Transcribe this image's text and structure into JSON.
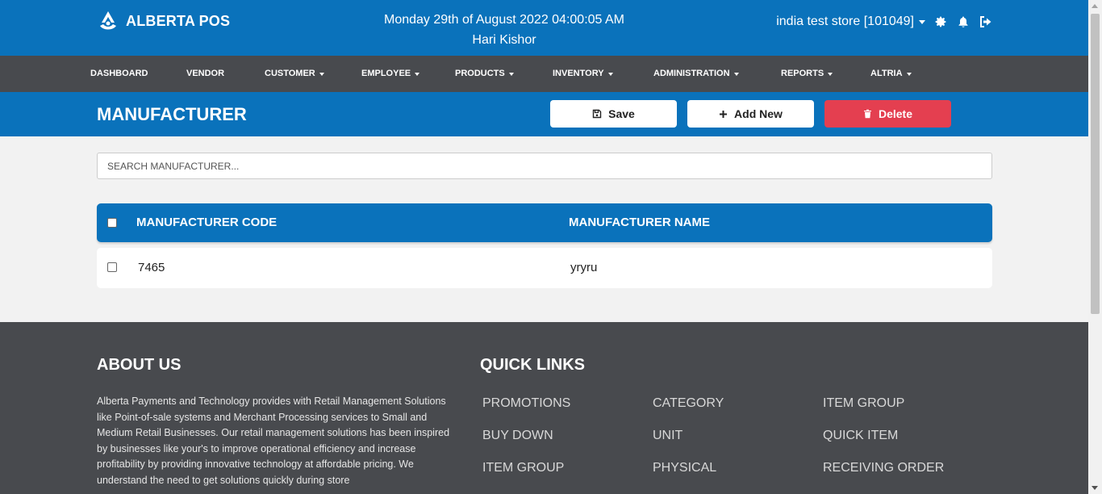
{
  "header": {
    "brand": "ALBERTA POS",
    "datetime": "Monday 29th of August 2022 04:00:05 AM",
    "user": "Hari Kishor",
    "store": "india test store [101049]"
  },
  "nav": {
    "dashboard": "DASHBOARD",
    "vendor": "VENDOR",
    "customer": "CUSTOMER",
    "employee": "EMPLOYEE",
    "products": "PRODUCTS",
    "inventory": "INVENTORY",
    "administration": "ADMINISTRATION",
    "reports": "REPORTS",
    "altria": "ALTRIA"
  },
  "page": {
    "title": "MANUFACTURER",
    "save_label": "Save",
    "add_label": "Add New",
    "delete_label": "Delete"
  },
  "search": {
    "placeholder": "SEARCH MANUFACTURER..."
  },
  "table": {
    "columns": [
      "MANUFACTURER CODE",
      "MANUFACTURER NAME"
    ],
    "rows": [
      {
        "code": "7465",
        "name": "yryru"
      }
    ]
  },
  "footer": {
    "about_heading": "ABOUT US",
    "about_text": "Alberta Payments and Technology provides with Retail Management Solutions like Point-of-sale systems and Merchant Processing services to Small and Medium Retail Businesses. Our retail management solutions has been inspired by businesses like your's to improve operational efficiency and increase profitability by providing innovative technology at affordable pricing. We understand the need to get solutions quickly during store",
    "links_heading": "QUICK LINKS",
    "links": [
      "PROMOTIONS",
      "CATEGORY",
      "ITEM GROUP",
      "BUY DOWN",
      "UNIT",
      "QUICK ITEM",
      "ITEM GROUP",
      "PHYSICAL",
      "RECEIVING ORDER"
    ]
  },
  "colors": {
    "primary": "#0a72bb",
    "nav_bg": "#484a4e",
    "danger": "#e43f50"
  },
  "icons": [
    "alberta-logo-icon",
    "caret-down-icon",
    "gear-icon",
    "bell-icon",
    "sign-out-icon",
    "save-icon",
    "plus-icon",
    "trash-icon",
    "checkbox-icon"
  ]
}
